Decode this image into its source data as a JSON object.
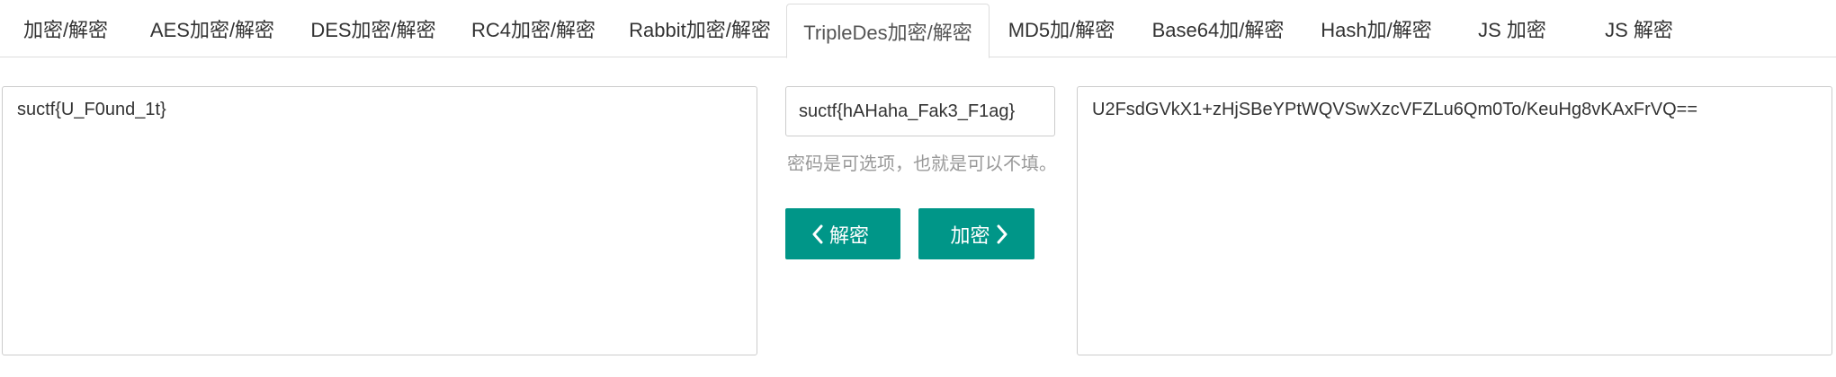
{
  "tabs": [
    {
      "label": "加密/解密"
    },
    {
      "label": "AES加密/解密"
    },
    {
      "label": "DES加密/解密"
    },
    {
      "label": "RC4加密/解密"
    },
    {
      "label": "Rabbit加密/解密"
    },
    {
      "label": "TripleDes加密/解密"
    },
    {
      "label": "MD5加/解密"
    },
    {
      "label": "Base64加/解密"
    },
    {
      "label": "Hash加/解密"
    },
    {
      "label": "JS 加密"
    },
    {
      "label": "JS 解密"
    }
  ],
  "active_tab": "TripleDes加密/解密",
  "plaintext": {
    "value": "suctf{U_F0und_1t}"
  },
  "key": {
    "value": "suctf{hAHaha_Fak3_F1ag}",
    "hint": "密码是可选项，也就是可以不填。"
  },
  "buttons": {
    "decrypt_label": "解密",
    "encrypt_label": "加密"
  },
  "ciphertext": {
    "value": "U2FsdGVkX1+zHjSBeYPtWQVSwXzcVFZLu6Qm0To/KeuHg8vKAxFrVQ=="
  },
  "colors": {
    "accent": "#009688",
    "border": "#cccccc",
    "hint": "#999999"
  }
}
